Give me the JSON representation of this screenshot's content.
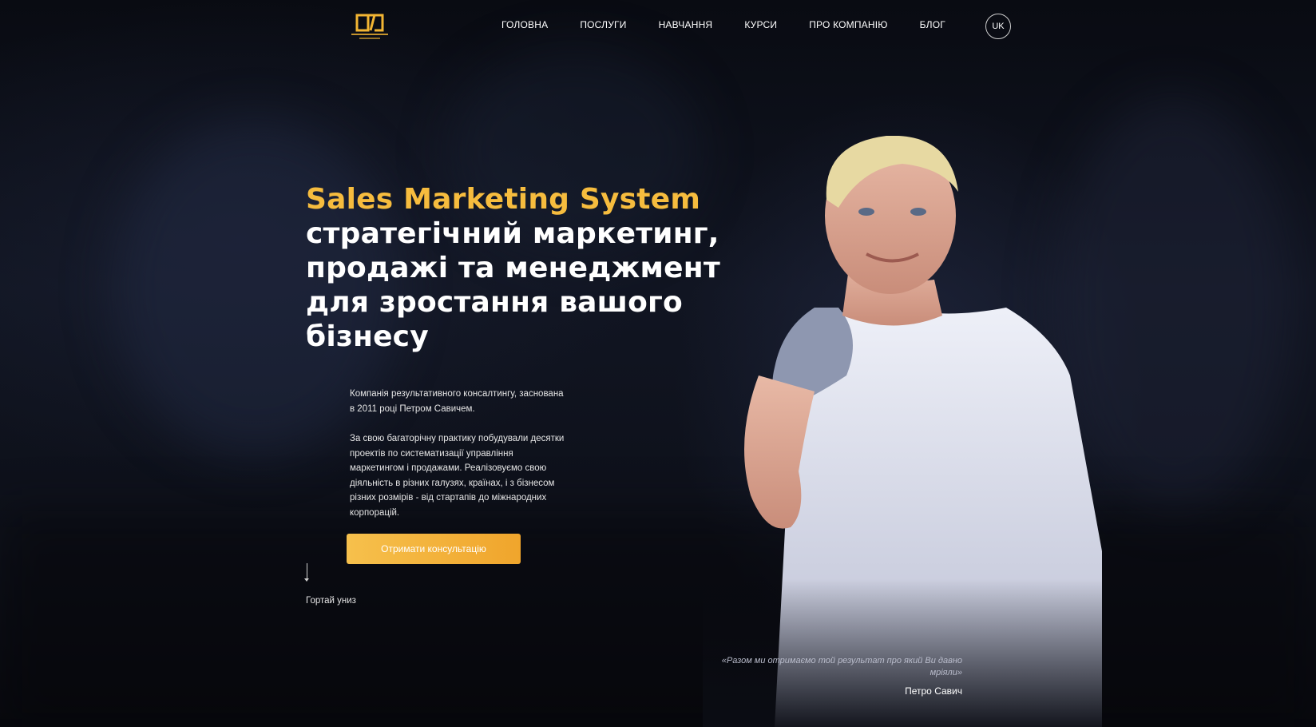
{
  "header": {
    "nav": [
      {
        "label": "ГОЛОВНА"
      },
      {
        "label": "ПОСЛУГИ"
      },
      {
        "label": "НАВЧАННЯ"
      },
      {
        "label": "КУРСИ"
      },
      {
        "label": "ПРО КОМПАНІЮ"
      },
      {
        "label": "БЛОГ"
      }
    ],
    "language": "UK"
  },
  "hero": {
    "brand": "Sales Marketing System",
    "title": "стратегічний маркетинг, продажі та менеджмент для зростання вашого бізнесу",
    "intro": "Компанія результативного консалтингу, заснована в 2011 році Петром Савичем.",
    "description": "За свою багаторічну практику побудували десятки проектів по систематизації управління маркетингом і продажами. Реалізовуємо свою діяльність в різних галузях, країнах, і з бізнесом різних розмірів - від стартапів до міжнародних корпорацій.",
    "cta_label": "Отримати консультацію",
    "scroll_label": "Гортай униз"
  },
  "quote": {
    "text": "«Разом ми отримаємо той результат про який Ви давно мріяли»",
    "author": "Петро Савич"
  },
  "colors": {
    "accent": "#f6bc3e",
    "button_start": "#f6c04c",
    "button_end": "#f0a52c",
    "background": "#0b0d14"
  }
}
